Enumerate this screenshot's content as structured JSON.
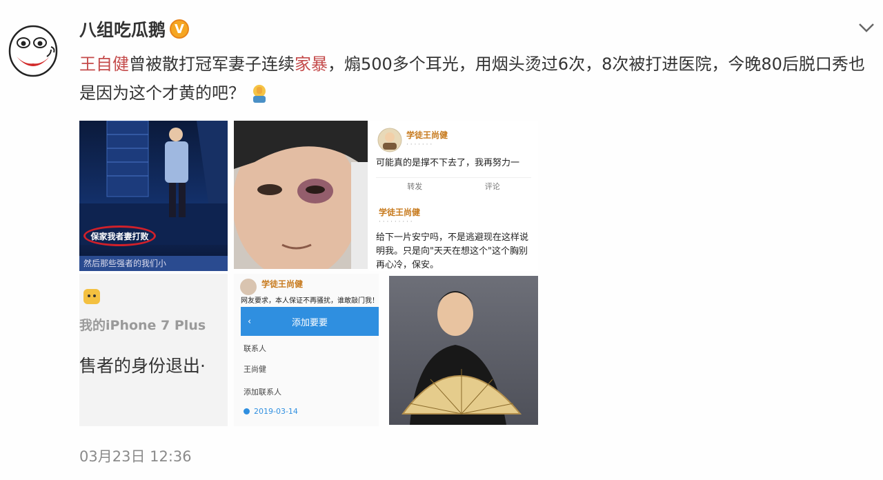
{
  "author": {
    "name": "八组吃瓜鹅",
    "verified_badge": "V"
  },
  "post": {
    "segments": [
      {
        "text": "王自健",
        "highlight": true
      },
      {
        "text": "曾被散打冠军妻子连续",
        "highlight": false
      },
      {
        "text": "家暴",
        "highlight": true
      },
      {
        "text": "，煽500多个耳光，用烟头烫过6次，8次被打进医院，今晚80后脱口秀也是因为这个才黄的吧？",
        "highlight": false
      }
    ],
    "emoji": "facepalm-emoji"
  },
  "images": {
    "stage_caption": "保家我者妻打败",
    "stage_strip": "然后那些强者的我们小",
    "weibo_user_1": "学徒王尚健",
    "weibo_body_1": "可能真的是撑不下去了，我再努力一",
    "weibo_actions": [
      "转发",
      "评论"
    ],
    "weibo_user_2": "学徒王尚健",
    "weibo_body_2": "给下一片安宁吗，不是逃避现在这样说明我。只是向\"天天在想这个\"这个胸别再心冷，保安。",
    "iphone_text": "我的iPhone 7 Plus",
    "reporter_text": "售者的身份退出·",
    "app_user": "学徒王尚健",
    "app_comment": "网友要求，本人保证不再骚扰，谁敢敲门我！",
    "app_title": "添加要要",
    "app_row_1": "联系人",
    "app_row_2": "王尚健",
    "app_row_3": "添加联系人",
    "app_date": "2019-03-14"
  },
  "timestamp": "03月23日 12:36",
  "colors": {
    "highlight": "#c44a4a",
    "badge": "#f5a623",
    "app_blue": "#2f8fe0"
  }
}
